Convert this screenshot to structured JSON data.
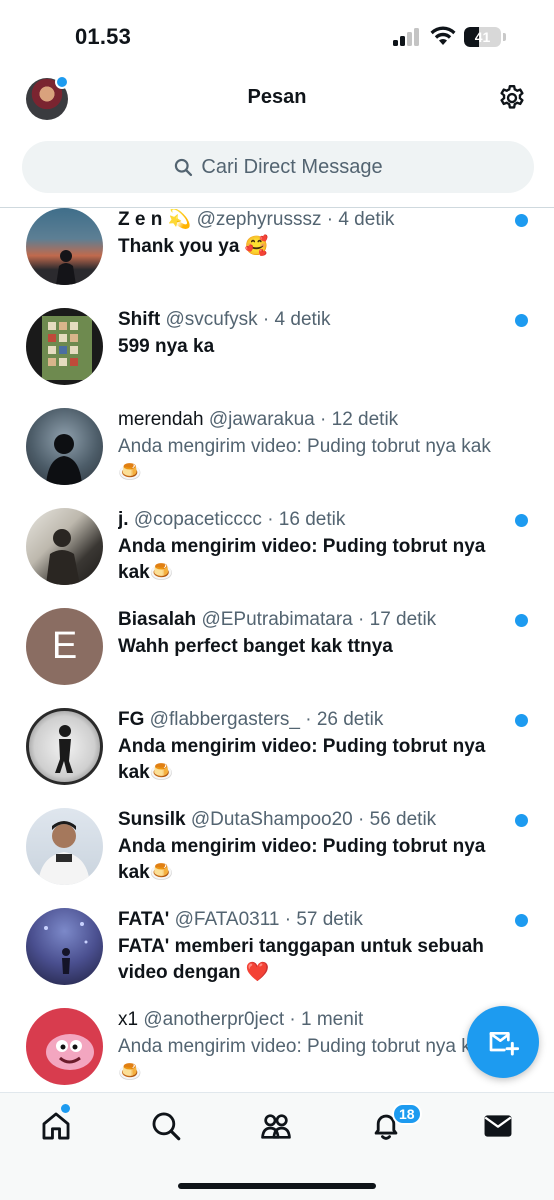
{
  "status_bar": {
    "time": "01.53",
    "battery_level": "41",
    "battery_fraction": 0.41
  },
  "header": {
    "title": "Pesan",
    "settings_icon": "gear-icon",
    "avatar_has_notification": true
  },
  "search": {
    "placeholder": "Cari Direct Message",
    "icon": "search-icon"
  },
  "conversations": [
    {
      "name": "Z e n 💫",
      "handle": "@zephyrusssz",
      "time": "· 4 detik",
      "message": "Thank you ya 🥰",
      "unread": true,
      "emoji_name": false
    },
    {
      "name": "Shift",
      "handle": "@svcufysk",
      "time": "· 4 detik",
      "message": "599 nya ka",
      "unread": true
    },
    {
      "name": "merendah",
      "handle": "@jawarakua",
      "time": "· 12 detik",
      "message": "Anda mengirim video: Puding tobrut nya kak 🍮",
      "unread": false
    },
    {
      "name": "j.",
      "handle": "@copaceticccc",
      "time": "· 16 detik",
      "message": "Anda mengirim video: Puding tobrut nya kak🍮",
      "unread": true
    },
    {
      "name": "Biasalah",
      "handle": "@EPutrabimatara",
      "time": "· 17 detik",
      "message": "Wahh perfect banget kak ttnya",
      "unread": true,
      "avatar_letter": "E"
    },
    {
      "name": "FG",
      "handle": "@flabbergasters_",
      "time": "· 26 detik",
      "message": "Anda mengirim video: Puding tobrut nya kak🍮",
      "unread": true
    },
    {
      "name": "Sunsilk",
      "handle": "@DutaShampoo20",
      "time": "· 56 detik",
      "message": "Anda mengirim video: Puding tobrut nya kak🍮",
      "unread": true
    },
    {
      "name": "FATA'",
      "handle": "@FATA0311",
      "time": "· 57 detik",
      "message": "FATA' memberi tanggapan untuk sebuah video dengan ❤️",
      "unread": true
    },
    {
      "name": "x1",
      "handle": "@anotherpr0ject",
      "time": "· 1 menit",
      "message": "Anda mengirim video: Puding tobrut nya kak 🍮",
      "unread": false
    }
  ],
  "fab": {
    "icon": "new-message-icon"
  },
  "bottom_nav": {
    "items": [
      {
        "icon": "home-icon",
        "active": true
      },
      {
        "icon": "search-icon"
      },
      {
        "icon": "communities-icon"
      },
      {
        "icon": "bell-icon",
        "badge": "18"
      },
      {
        "icon": "mail-icon",
        "active": true
      }
    ]
  },
  "colors": {
    "accent": "#1d9bf0",
    "text": "#0f1419",
    "muted": "#536471",
    "search_bg": "#eff3f4"
  }
}
